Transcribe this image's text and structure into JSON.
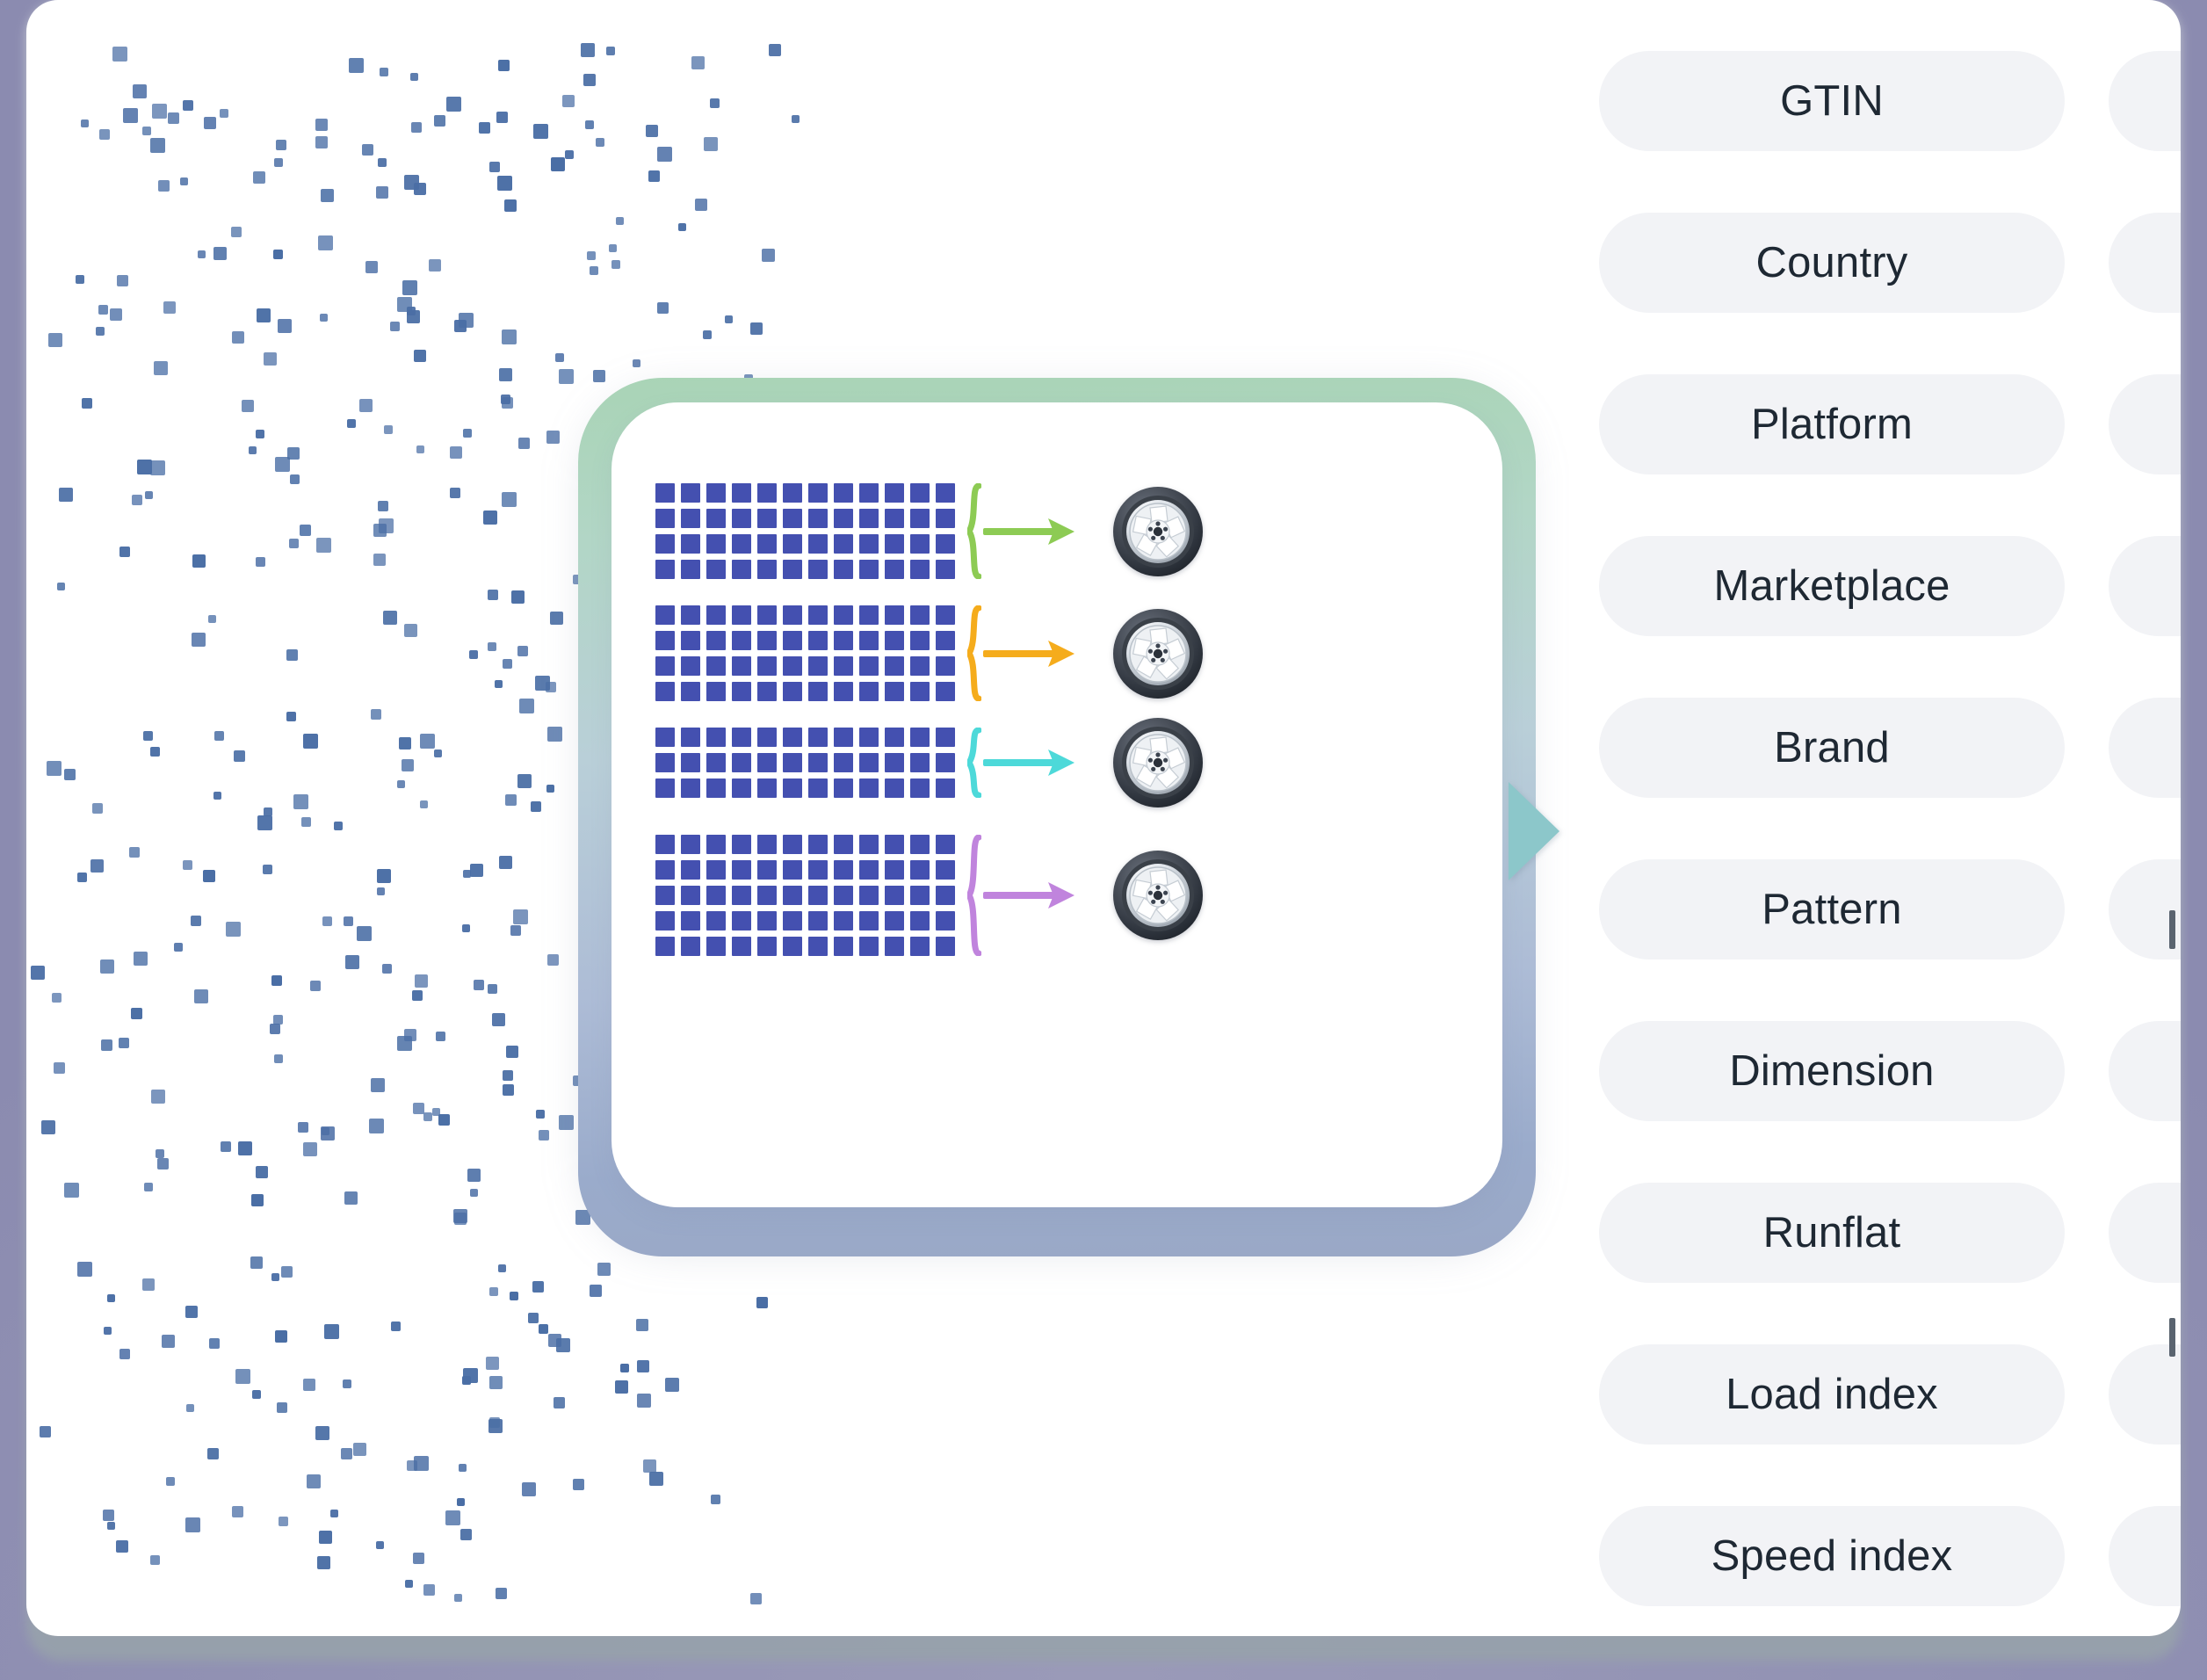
{
  "theme": {
    "frame_bg": "#8b8bb0",
    "stage_bg": "#ffffff",
    "tile_blue": "#4450b0",
    "speckle_blue": "#4a6ea5",
    "pill_bg": "#f2f3f6",
    "pill_text": "#1e2833",
    "card_border_top": "#a9d4b6",
    "card_border_bottom": "#9aa8c6",
    "chevron": "#8cc7ca"
  },
  "diagram": {
    "name": "tire-clustering-diagram",
    "caption_present": false,
    "groups": [
      {
        "id": "group-1",
        "rows": 4,
        "cols": 12,
        "accent_color": "#8dcb54",
        "accent_name": "green",
        "output_icon": "tire-wheel-icon"
      },
      {
        "id": "group-2",
        "rows": 4,
        "cols": 12,
        "accent_color": "#f5ac1c",
        "accent_name": "orange",
        "output_icon": "tire-wheel-icon"
      },
      {
        "id": "group-3",
        "rows": 3,
        "cols": 12,
        "accent_color": "#4dd9d9",
        "accent_name": "cyan",
        "output_icon": "tire-wheel-icon"
      },
      {
        "id": "group-4",
        "rows": 5,
        "cols": 12,
        "accent_color": "#c084dd",
        "accent_name": "purple",
        "output_icon": "tire-wheel-icon"
      }
    ]
  },
  "attribute_list": {
    "name": "tire-attribute-pills",
    "items": [
      {
        "label": "GTIN"
      },
      {
        "label": "Country"
      },
      {
        "label": "Platform"
      },
      {
        "label": "Marketplace"
      },
      {
        "label": "Brand"
      },
      {
        "label": "Pattern"
      },
      {
        "label": "Dimension"
      },
      {
        "label": "Runflat"
      },
      {
        "label": "Load index"
      },
      {
        "label": "Speed index"
      }
    ],
    "peek_column_count": 10
  }
}
